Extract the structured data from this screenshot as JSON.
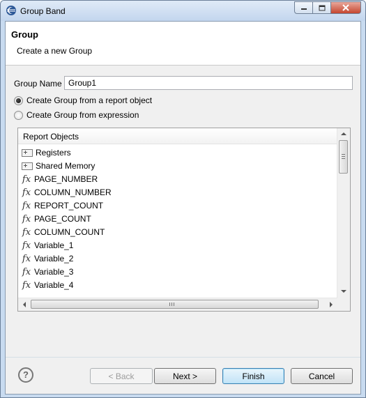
{
  "window": {
    "title": "Group Band",
    "app_icon": "eclipse-icon",
    "buttons": [
      "minimize-icon",
      "maximize-icon",
      "close-icon"
    ]
  },
  "banner": {
    "title": "Group",
    "description": "Create a new Group"
  },
  "form": {
    "group_name_label": "Group Name",
    "group_name_value": "Group1",
    "options": [
      {
        "label": "Create Group from a report object",
        "selected": true
      },
      {
        "label": "Create Group from expression",
        "selected": false
      }
    ]
  },
  "tree": {
    "header": "Report Objects",
    "items": [
      {
        "label": "Registers",
        "icon": "expand-box-icon"
      },
      {
        "label": "Shared Memory",
        "icon": "expand-box-icon"
      },
      {
        "label": "PAGE_NUMBER",
        "icon": "fx-icon"
      },
      {
        "label": "COLUMN_NUMBER",
        "icon": "fx-icon"
      },
      {
        "label": "REPORT_COUNT",
        "icon": "fx-icon"
      },
      {
        "label": "PAGE_COUNT",
        "icon": "fx-icon"
      },
      {
        "label": "COLUMN_COUNT",
        "icon": "fx-icon"
      },
      {
        "label": "Variable_1",
        "icon": "fx-icon"
      },
      {
        "label": "Variable_2",
        "icon": "fx-icon"
      },
      {
        "label": "Variable_3",
        "icon": "fx-icon"
      },
      {
        "label": "Variable_4",
        "icon": "fx-icon"
      }
    ]
  },
  "footer": {
    "help_glyph": "?",
    "back_label": "< Back",
    "next_label": "Next >",
    "finish_label": "Finish",
    "cancel_label": "Cancel"
  },
  "colors": {
    "title_bar": "#c8dbf0",
    "close_button": "#c5462f",
    "default_button_border": "#3c7fb1"
  }
}
